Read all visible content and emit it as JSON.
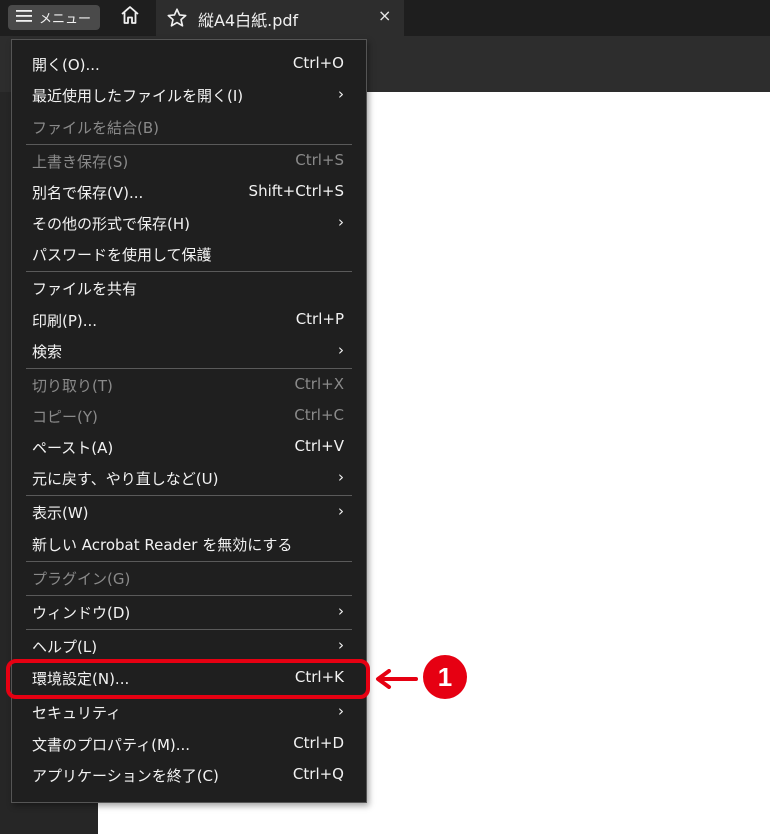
{
  "topbar": {
    "menu_button_label": "メニュー",
    "tab_title": "縦A4白紙.pdf",
    "tab_close": "×"
  },
  "menu": {
    "items": [
      {
        "label": "開く(O)...",
        "shortcut": "Ctrl+O",
        "disabled": false,
        "submenu": false
      },
      {
        "label": "最近使用したファイルを開く(I)",
        "shortcut": "",
        "disabled": false,
        "submenu": true
      },
      {
        "label": "ファイルを結合(B)",
        "shortcut": "",
        "disabled": true,
        "submenu": false
      },
      {
        "label": "上書き保存(S)",
        "shortcut": "Ctrl+S",
        "disabled": true,
        "submenu": false
      },
      {
        "label": "別名で保存(V)...",
        "shortcut": "Shift+Ctrl+S",
        "disabled": false,
        "submenu": false
      },
      {
        "label": "その他の形式で保存(H)",
        "shortcut": "",
        "disabled": false,
        "submenu": true
      },
      {
        "label": "パスワードを使用して保護",
        "shortcut": "",
        "disabled": false,
        "submenu": false
      },
      {
        "label": "ファイルを共有",
        "shortcut": "",
        "disabled": false,
        "submenu": false
      },
      {
        "label": "印刷(P)...",
        "shortcut": "Ctrl+P",
        "disabled": false,
        "submenu": false
      },
      {
        "label": "検索",
        "shortcut": "",
        "disabled": false,
        "submenu": true
      },
      {
        "label": "切り取り(T)",
        "shortcut": "Ctrl+X",
        "disabled": true,
        "submenu": false
      },
      {
        "label": "コピー(Y)",
        "shortcut": "Ctrl+C",
        "disabled": true,
        "submenu": false
      },
      {
        "label": "ペースト(A)",
        "shortcut": "Ctrl+V",
        "disabled": false,
        "submenu": false
      },
      {
        "label": "元に戻す、やり直しなど(U)",
        "shortcut": "",
        "disabled": false,
        "submenu": true
      },
      {
        "label": "表示(W)",
        "shortcut": "",
        "disabled": false,
        "submenu": true
      },
      {
        "label": "新しい Acrobat Reader を無効にする",
        "shortcut": "",
        "disabled": false,
        "submenu": false
      },
      {
        "label": "プラグイン(G)",
        "shortcut": "",
        "disabled": true,
        "submenu": false
      },
      {
        "label": "ウィンドウ(D)",
        "shortcut": "",
        "disabled": false,
        "submenu": true
      },
      {
        "label": "ヘルプ(L)",
        "shortcut": "",
        "disabled": false,
        "submenu": true
      },
      {
        "label": "環境設定(N)...",
        "shortcut": "Ctrl+K",
        "disabled": false,
        "submenu": false
      },
      {
        "label": "セキュリティ",
        "shortcut": "",
        "disabled": false,
        "submenu": true
      },
      {
        "label": "文書のプロパティ(M)...",
        "shortcut": "Ctrl+D",
        "disabled": false,
        "submenu": false
      },
      {
        "label": "アプリケーションを終了(C)",
        "shortcut": "Ctrl+Q",
        "disabled": false,
        "submenu": false
      }
    ],
    "submenu_glyph": "›"
  },
  "annotation": {
    "badge_text": "1",
    "color": "#e60012"
  }
}
